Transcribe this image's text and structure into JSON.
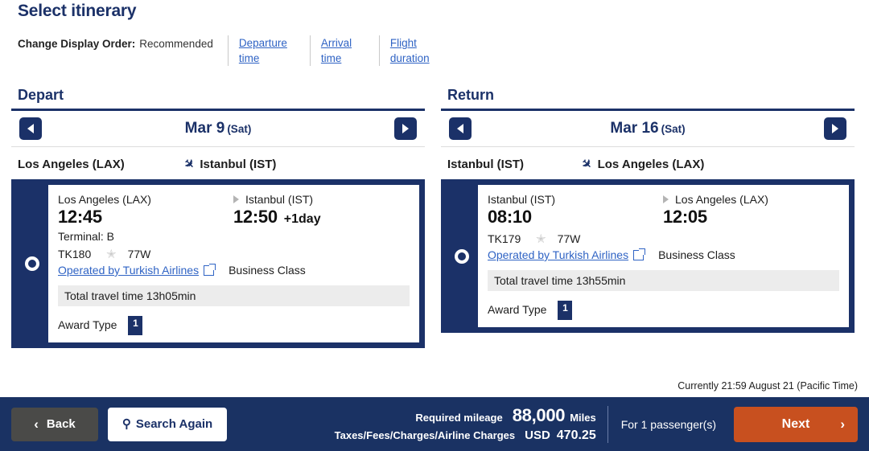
{
  "header": {
    "title": "Select itinerary",
    "sort_label": "Change Display Order:",
    "sort_current": "Recommended",
    "sort_options": [
      {
        "line1": "Departure",
        "line2": "time"
      },
      {
        "line1": "Arrival",
        "line2": "time"
      },
      {
        "line1": "Flight",
        "line2": "duration"
      }
    ]
  },
  "depart": {
    "heading": "Depart",
    "date": "Mar 9",
    "dow": "(Sat)",
    "prev_icon": "triangle-left-icon",
    "next_icon": "triangle-right-icon",
    "route_from": "Los Angeles (LAX)",
    "route_to": "Istanbul (IST)",
    "flight": {
      "dep_city": "Los Angeles (LAX)",
      "arr_city": "Istanbul (IST)",
      "dep_time": "12:45",
      "arr_time": "12:50",
      "day_offset": "+1day",
      "terminal": "Terminal: B",
      "flight_no": "TK180",
      "equipment": "77W",
      "operated_by": "Operated by Turkish Airlines",
      "cabin": "Business Class",
      "total_travel_time": "Total travel time 13h05min",
      "award_label": "Award Type",
      "award_badge": "1",
      "selected": true
    }
  },
  "return": {
    "heading": "Return",
    "date": "Mar 16",
    "dow": "(Sat)",
    "prev_icon": "triangle-left-icon",
    "next_icon": "triangle-right-icon",
    "route_from": "Istanbul (IST)",
    "route_to": "Los Angeles (LAX)",
    "flight": {
      "dep_city": "Istanbul (IST)",
      "arr_city": "Los Angeles (LAX)",
      "dep_time": "08:10",
      "arr_time": "12:05",
      "day_offset": "",
      "flight_no": "TK179",
      "equipment": "77W",
      "operated_by": "Operated by Turkish Airlines",
      "cabin": "Business Class",
      "total_travel_time": "Total travel time 13h55min",
      "award_label": "Award Type",
      "award_badge": "1",
      "selected": true
    }
  },
  "timestamp": "Currently 21:59 August 21 (Pacific Time)",
  "footer": {
    "back_label": "Back",
    "back_icon": "chevron-left-icon",
    "search_label": "Search Again",
    "search_icon": "search-icon",
    "mileage_label": "Required mileage",
    "mileage_value": "88,000",
    "mileage_unit": "Miles",
    "taxes_label": "Taxes/Fees/Charges/Airline Charges",
    "taxes_currency": "USD",
    "taxes_amount": "470.25",
    "passengers": "For 1 passenger(s)",
    "next_label": "Next",
    "next_icon": "chevron-right-icon"
  },
  "colors": {
    "navy": "#1b3168",
    "footer_navy": "#1a3263",
    "link_blue": "#2f63c4",
    "orange": "#c8501f",
    "gray_button": "#4a4a48",
    "row_gray": "#ececec"
  }
}
